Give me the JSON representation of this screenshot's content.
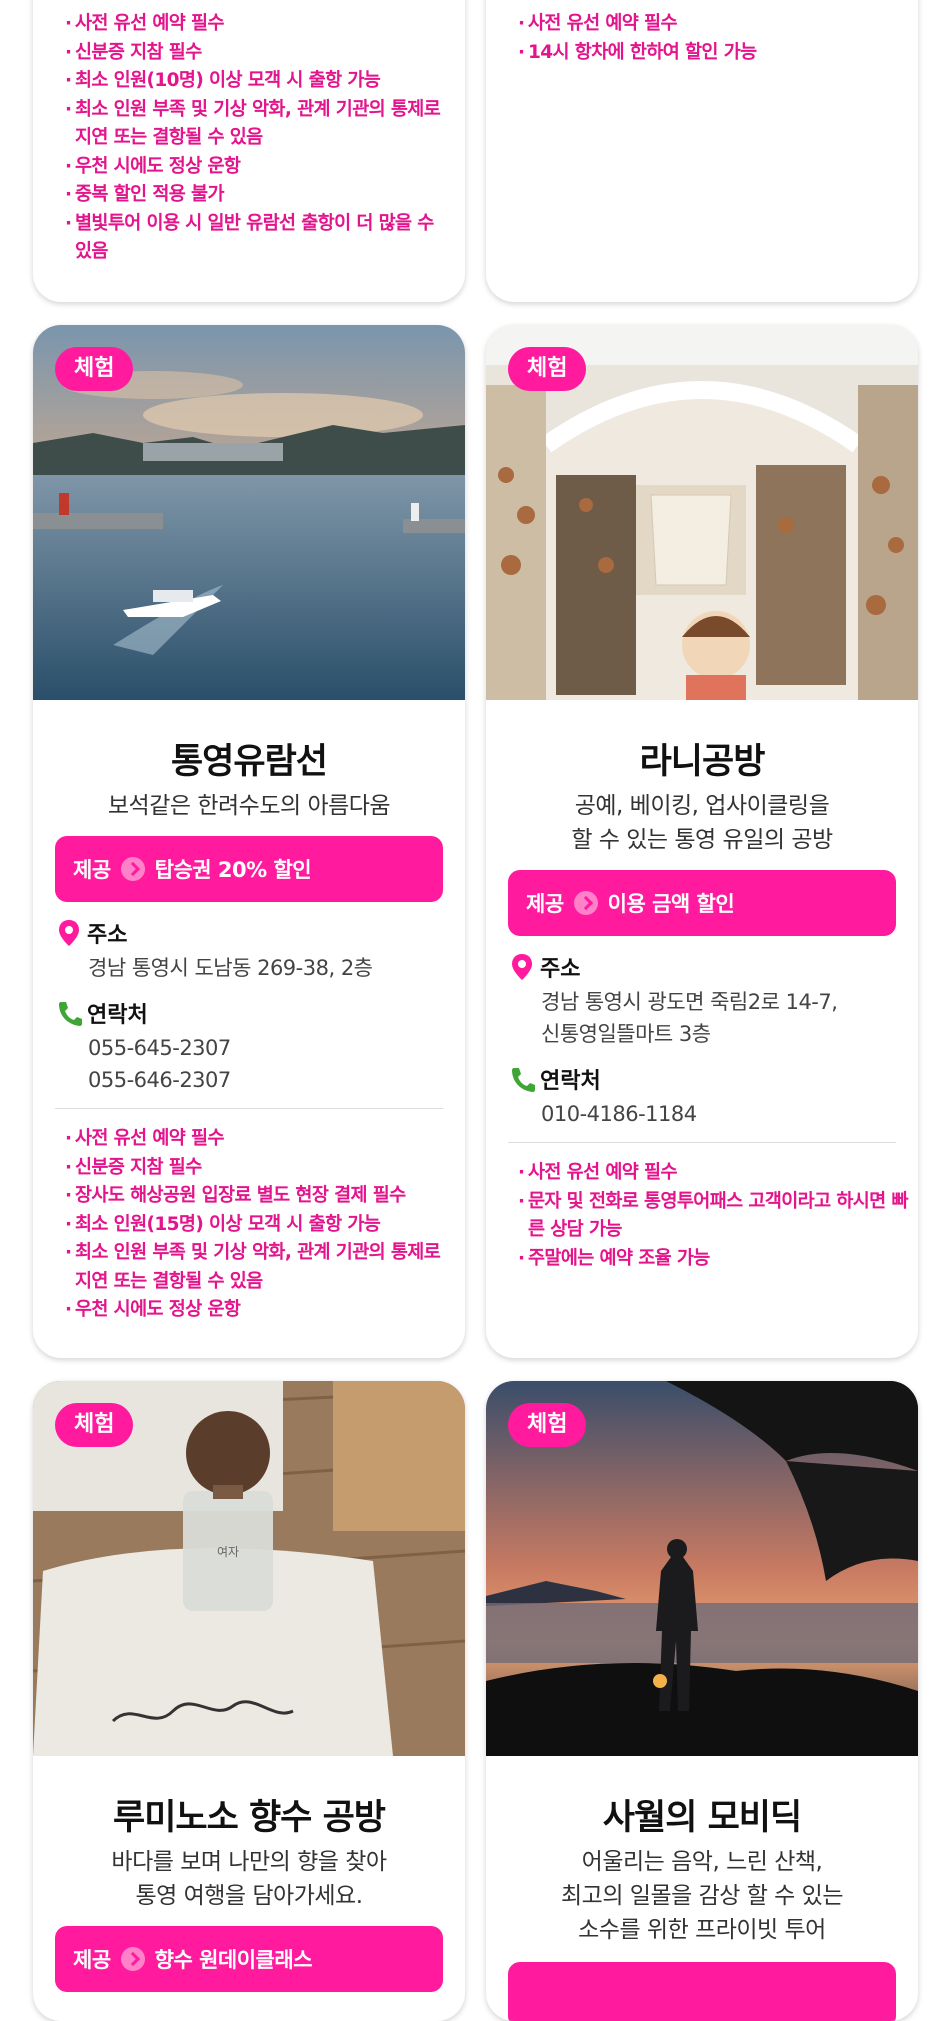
{
  "top_cards": [
    {
      "notes": [
        "사전 유선 예약 필수",
        "신분증 지참 필수",
        "최소 인원(10명) 이상 모객 시 출항 가능",
        "최소 인원 부족 및 기상 악화, 관계 기관의 통제로 지연 또는 결항될 수 있음",
        "우천 시에도 정상 운항",
        "중복 할인 적용 불가",
        "별빛투어 이용 시 일반 유람선 출항이 더 많을 수 있음"
      ]
    },
    {
      "notes": [
        "사전 유선 예약 필수",
        "14시 항차에 한하여 할인 가능"
      ]
    }
  ],
  "cards": [
    {
      "badge": "체험",
      "title": "통영유람선",
      "subtitle": [
        "보석같은 한려수도의 아름다움"
      ],
      "offer_prefix": "제공",
      "offer": "탑승권 20% 할인",
      "address_label": "주소",
      "address": [
        "경남 통영시 도남동 269-38, 2층"
      ],
      "contact_label": "연락처",
      "contacts": [
        "055-645-2307",
        "055-646-2307"
      ],
      "notes": [
        "사전 유선 예약 필수",
        "신분증 지참 필수",
        "장사도 해상공원 입장료 별도 현장 결제 필수",
        "최소 인원(15명) 이상 모객 시 출항 가능",
        "최소 인원 부족 및 기상 악화, 관계 기관의 통제로 지연 또는 결항될 수 있음",
        "우천 시에도 정상 운항"
      ]
    },
    {
      "badge": "체험",
      "title": "라니공방",
      "subtitle": [
        "공예, 베이킹, 업사이클링을",
        "할 수 있는 통영 유일의 공방"
      ],
      "offer_prefix": "제공",
      "offer": "이용 금액 할인",
      "address_label": "주소",
      "address": [
        "경남 통영시 광도면 죽림2로 14-7,",
        "신통영일뜰마트 3층"
      ],
      "contact_label": "연락처",
      "contacts": [
        "010-4186-1184"
      ],
      "notes": [
        "사전 유선 예약 필수",
        "문자 및 전화로 통영투어패스 고객이라고 하시면 빠른 상담 가능",
        "주말에는 예약 조율 가능"
      ]
    },
    {
      "badge": "체험",
      "title": "루미노소 향수 공방",
      "subtitle": [
        "바다를 보며 나만의 향을 찾아",
        "통영 여행을 담아가세요."
      ],
      "offer_prefix": "제공",
      "offer": "향수 원데이클래스",
      "bottle_label": "여자"
    },
    {
      "badge": "체험",
      "title": "사월의 모비딕",
      "subtitle": [
        "어울리는 음악, 느린 산책,",
        "최고의 일몰을 감상 할 수 있는",
        "소수를 위한 프라이빗 투어"
      ]
    }
  ],
  "colors": {
    "accent": "#ff1a9e",
    "note_text": "#e3148c"
  },
  "icons": {
    "address": "map-pin-icon",
    "contact": "phone-icon",
    "offer": "chevron-right-icon"
  }
}
